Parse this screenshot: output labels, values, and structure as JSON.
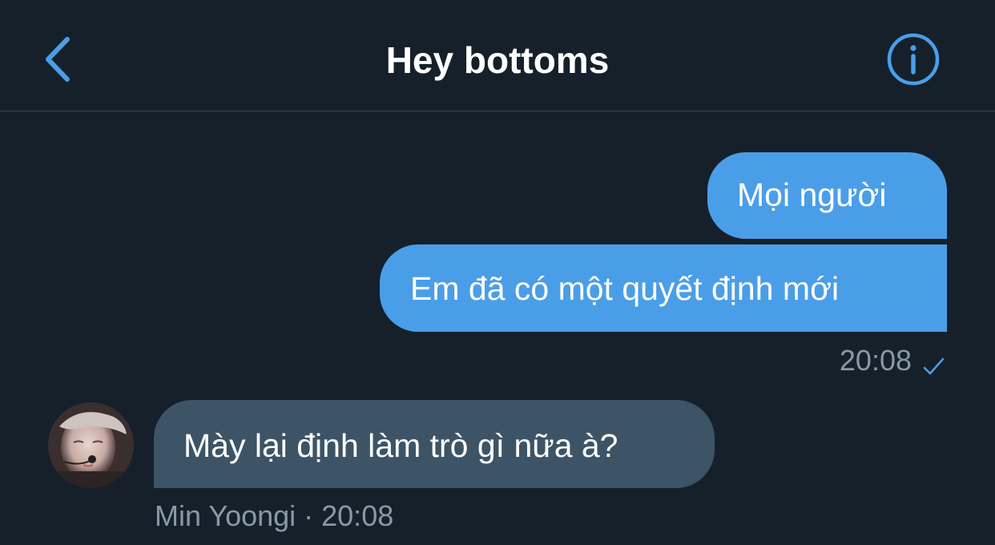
{
  "header": {
    "title": "Hey bottoms",
    "back_icon": "chevron-left-icon",
    "info_icon": "info-circle-icon"
  },
  "messages": [
    {
      "direction": "outgoing",
      "text": "Mọi người"
    },
    {
      "direction": "outgoing",
      "text": "Em đã có một quyết định mới"
    },
    {
      "direction": "incoming",
      "text": "Mày lại định làm trò gì nữa à?"
    }
  ],
  "outgoing_meta": {
    "time": "20:08",
    "status_icon": "check-icon"
  },
  "incoming_meta": {
    "text": "Min Yoongi · 20:08"
  },
  "colors": {
    "background": "#15202b",
    "accent": "#4a9ee8",
    "incoming_bubble": "#3d5466",
    "secondary_text": "#8899a6",
    "divider": "#38444d"
  }
}
